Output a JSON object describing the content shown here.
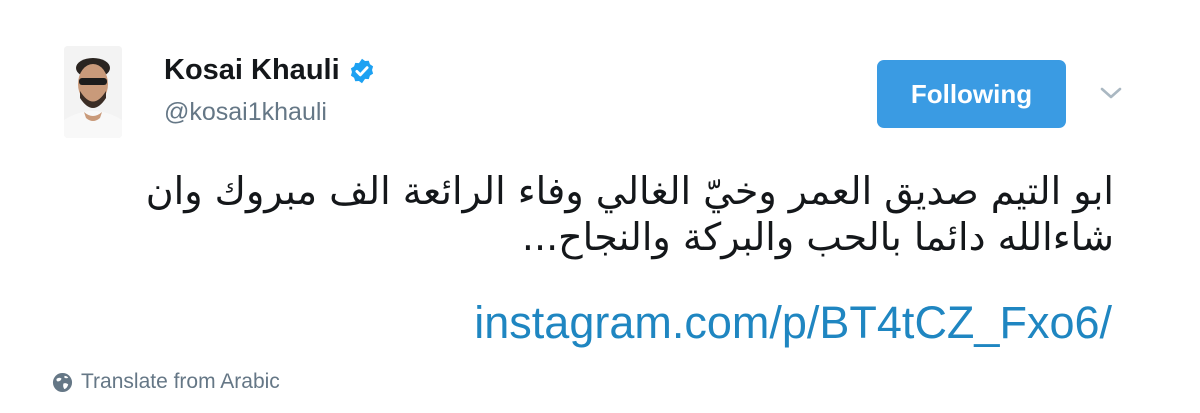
{
  "tweet": {
    "author": {
      "display_name": "Kosai Khauli",
      "handle": "@kosai1khauli",
      "verified": true,
      "avatar_icon": "avatar-photo"
    },
    "follow_button": {
      "label": "Following"
    },
    "menu_icon": "chevron-down-icon",
    "text_lines": [
      "ابو التيم صديق العمر وخيّ الغالي وفاء الرائعة الف مبروك وان",
      "شاءالله دائما بالحب والبركة والنجاح..."
    ],
    "link": "instagram.com/p/BT4tCZ_Fxo6/",
    "translate": {
      "icon": "globe-icon",
      "label": "Translate from Arabic"
    }
  },
  "colors": {
    "follow_button_bg": "#3a9be3",
    "link": "#1f86c1",
    "verified_badge": "#1da1f2",
    "secondary_text": "#657786"
  }
}
